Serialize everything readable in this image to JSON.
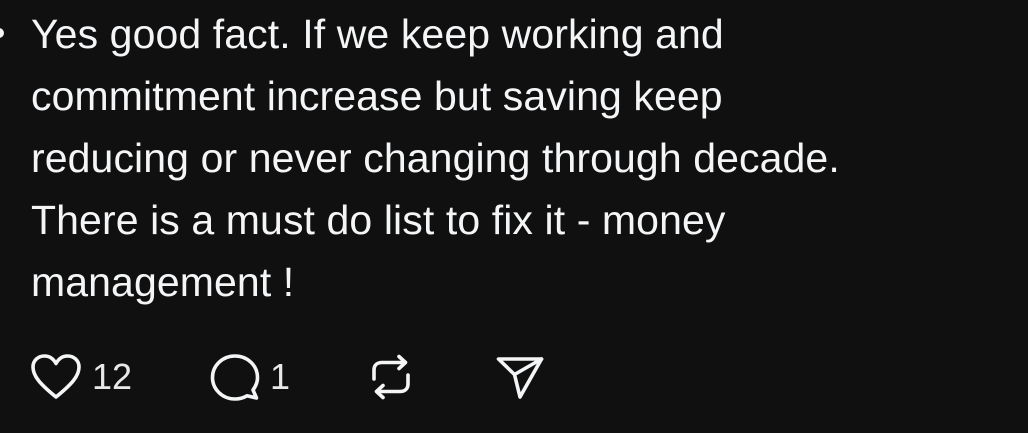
{
  "post": {
    "body": "Yes good fact. If we keep working and\ncommitment increase but saving keep\nreducing or never changing through decade.\nThere is a must do list to fix it - money\nmanagement !"
  },
  "actions": {
    "like_icon": "heart-icon",
    "like_count": "12",
    "comment_icon": "comment-bubble-icon",
    "comment_count": "1",
    "repost_icon": "repost-icon",
    "share_icon": "send-icon"
  },
  "colors": {
    "background": "#101010",
    "text": "#f3f5f7"
  }
}
